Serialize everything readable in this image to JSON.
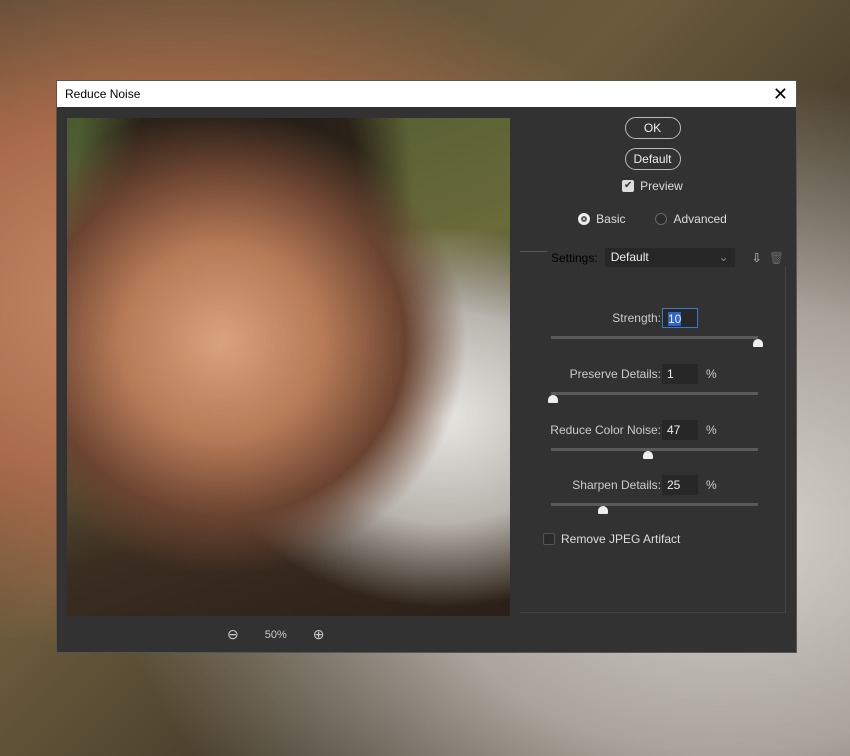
{
  "dialog": {
    "title": "Reduce Noise",
    "close": "✕"
  },
  "buttons": {
    "ok": "OK",
    "default": "Default"
  },
  "preview_checkbox": {
    "label": "Preview",
    "checked": true
  },
  "mode": {
    "basic": "Basic",
    "advanced": "Advanced",
    "selected": "basic"
  },
  "settings": {
    "label": "Settings:",
    "value": "Default",
    "chevron": "⌄"
  },
  "fields": [
    {
      "label": "Strength:",
      "value": "10",
      "unit": "",
      "slider_fraction": 1.0
    },
    {
      "label": "Preserve Details:",
      "value": "1",
      "unit": "%",
      "slider_fraction": 0.01
    },
    {
      "label": "Reduce Color Noise:",
      "value": "47",
      "unit": "%",
      "slider_fraction": 0.47
    },
    {
      "label": "Sharpen Details:",
      "value": "25",
      "unit": "%",
      "slider_fraction": 0.25
    }
  ],
  "jpeg": {
    "label": "Remove JPEG Artifact",
    "checked": false
  },
  "zoom": {
    "level": "50%",
    "zoom_out": "⊖",
    "zoom_in": "⊕"
  }
}
